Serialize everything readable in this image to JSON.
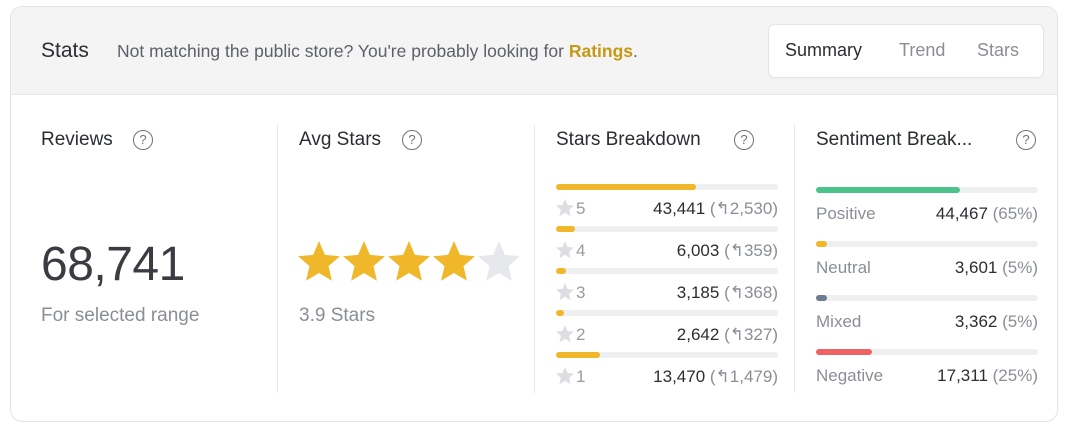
{
  "header": {
    "title": "Stats",
    "note": "Not matching the public store? You're probably looking for ",
    "link": "Ratings",
    "note_end": ".",
    "tabs": [
      {
        "label": "Summary",
        "active": true
      },
      {
        "label": "Trend",
        "active": false
      },
      {
        "label": "Stars",
        "active": false
      }
    ]
  },
  "reviews": {
    "title": "Reviews",
    "help": "?",
    "count": "68,741",
    "caption": "For selected range"
  },
  "avg_stars": {
    "title": "Avg Stars",
    "help": "?",
    "rating": 3.9,
    "rating_max": 5,
    "caption": "3.9 Stars"
  },
  "stars_breakdown": {
    "title": "Stars Breakdown",
    "help": "?",
    "rows": [
      {
        "stars": "5",
        "value": "43,441",
        "delta": "(↰2,530)",
        "fraction": 0.632
      },
      {
        "stars": "4",
        "value": "6,003",
        "delta": "(↰359)",
        "fraction": 0.087
      },
      {
        "stars": "3",
        "value": "3,185",
        "delta": "(↰368)",
        "fraction": 0.046
      },
      {
        "stars": "2",
        "value": "2,642",
        "delta": "(↰327)",
        "fraction": 0.038
      },
      {
        "stars": "1",
        "value": "13,470",
        "delta": "(↰1,479)",
        "fraction": 0.196
      }
    ],
    "bar_color": "#f0b72a"
  },
  "sentiment": {
    "title": "Sentiment Break...",
    "help": "?",
    "rows": [
      {
        "label": "Positive",
        "value": "44,467",
        "pct": "(65%)",
        "fraction": 0.65,
        "color": "#4cc38a"
      },
      {
        "label": "Neutral",
        "value": "3,601",
        "pct": "(5%)",
        "fraction": 0.05,
        "color": "#f0b72a"
      },
      {
        "label": "Mixed",
        "value": "3,362",
        "pct": "(5%)",
        "fraction": 0.05,
        "color": "#6b7c93"
      },
      {
        "label": "Negative",
        "value": "17,311",
        "pct": "(25%)",
        "fraction": 0.25,
        "color": "#ef6363"
      }
    ]
  },
  "colors": {
    "star_filled": "#f0b72a",
    "star_empty": "#e6e8ec",
    "row_star": "#dcdee2",
    "link": "#c49a12"
  },
  "icons": [
    "help-icon",
    "star-icon",
    "reply-arrow-icon"
  ]
}
